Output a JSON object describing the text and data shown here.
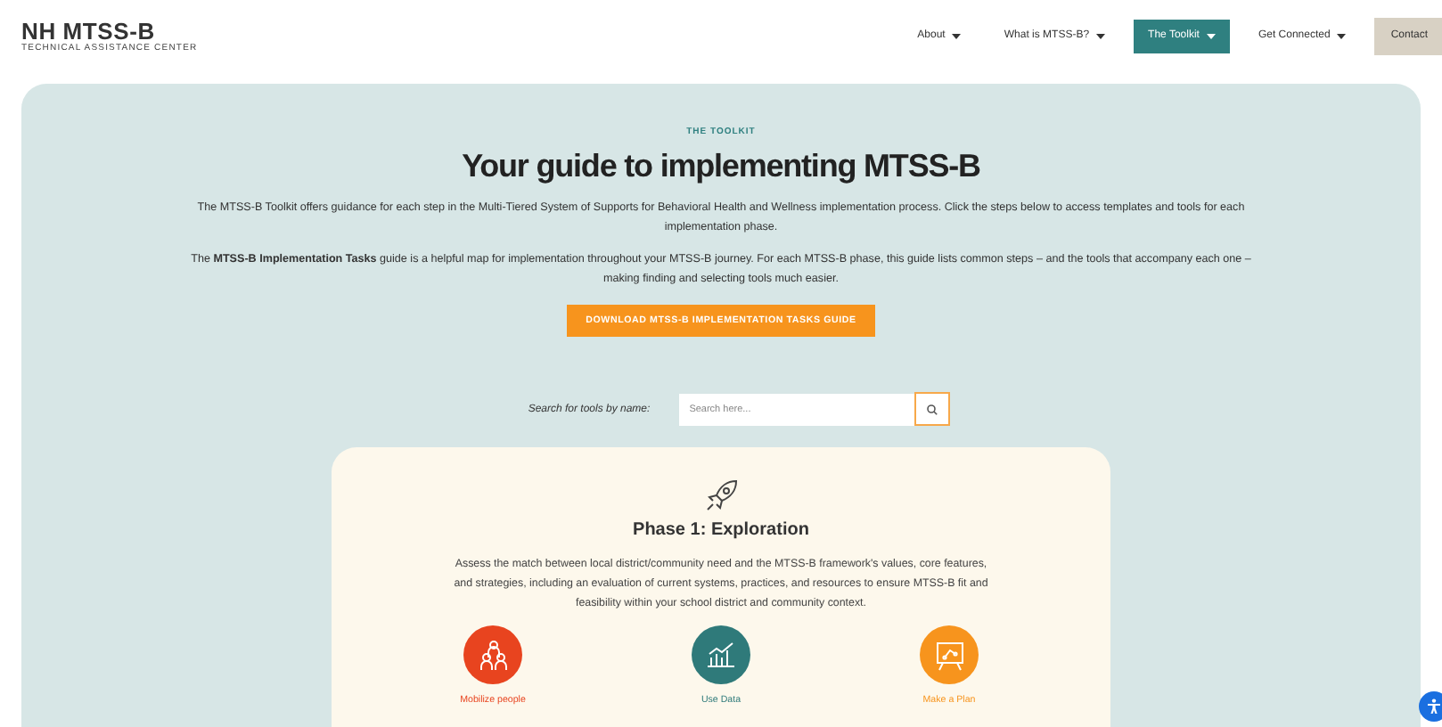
{
  "logo": {
    "title": "NH MTSS-B",
    "subtitle": "TECHNICAL ASSISTANCE CENTER"
  },
  "nav": [
    {
      "label": "About",
      "has_menu": true,
      "selected": false,
      "kind": "link"
    },
    {
      "label": "What is MTSS-B?",
      "has_menu": true,
      "selected": false,
      "kind": "link"
    },
    {
      "label": "The Toolkit",
      "has_menu": true,
      "selected": true,
      "kind": "link"
    },
    {
      "label": "Get Connected",
      "has_menu": true,
      "selected": false,
      "kind": "link"
    },
    {
      "label": "Contact",
      "has_menu": false,
      "selected": false,
      "kind": "button"
    }
  ],
  "hero": {
    "eyebrow": "THE TOOLKIT",
    "title": "Your guide to implementing MTSS-B",
    "paragraphs": [
      "The MTSS-B Toolkit offers guidance for each step in the Multi-Tiered System of Supports for Behavioral Health and Wellness implementation process. Click the steps below to access templates and tools for each implementation phase.",
      "The **MTSS-B Implementation Tasks** guide is a helpful map for implementation throughout your MTSS-B journey. For each MTSS-B phase, this guide lists common steps – and the tools that accompany each one – making finding and selecting tools much easier."
    ],
    "button": "DOWNLOAD MTSS-B IMPLEMENTATION TASKS GUIDE"
  },
  "search": {
    "label": "Search for tools by name:",
    "placeholder": "Search here..."
  },
  "phase": {
    "title": "Phase 1: Exploration",
    "description": "Assess the match between local district/community need and the MTSS-B framework's values, core features, and strategies, including an evaluation of current systems, practices, and resources to ensure MTSS-B fit and feasibility within your school district and community context.",
    "steps": [
      {
        "label": "Mobilize people",
        "color": "#e8441f",
        "kind": "people"
      },
      {
        "label": "Use Data",
        "color": "#2f7a7a",
        "kind": "data"
      },
      {
        "label": "Make a Plan",
        "color": "#f7941d",
        "kind": "plan"
      }
    ]
  }
}
